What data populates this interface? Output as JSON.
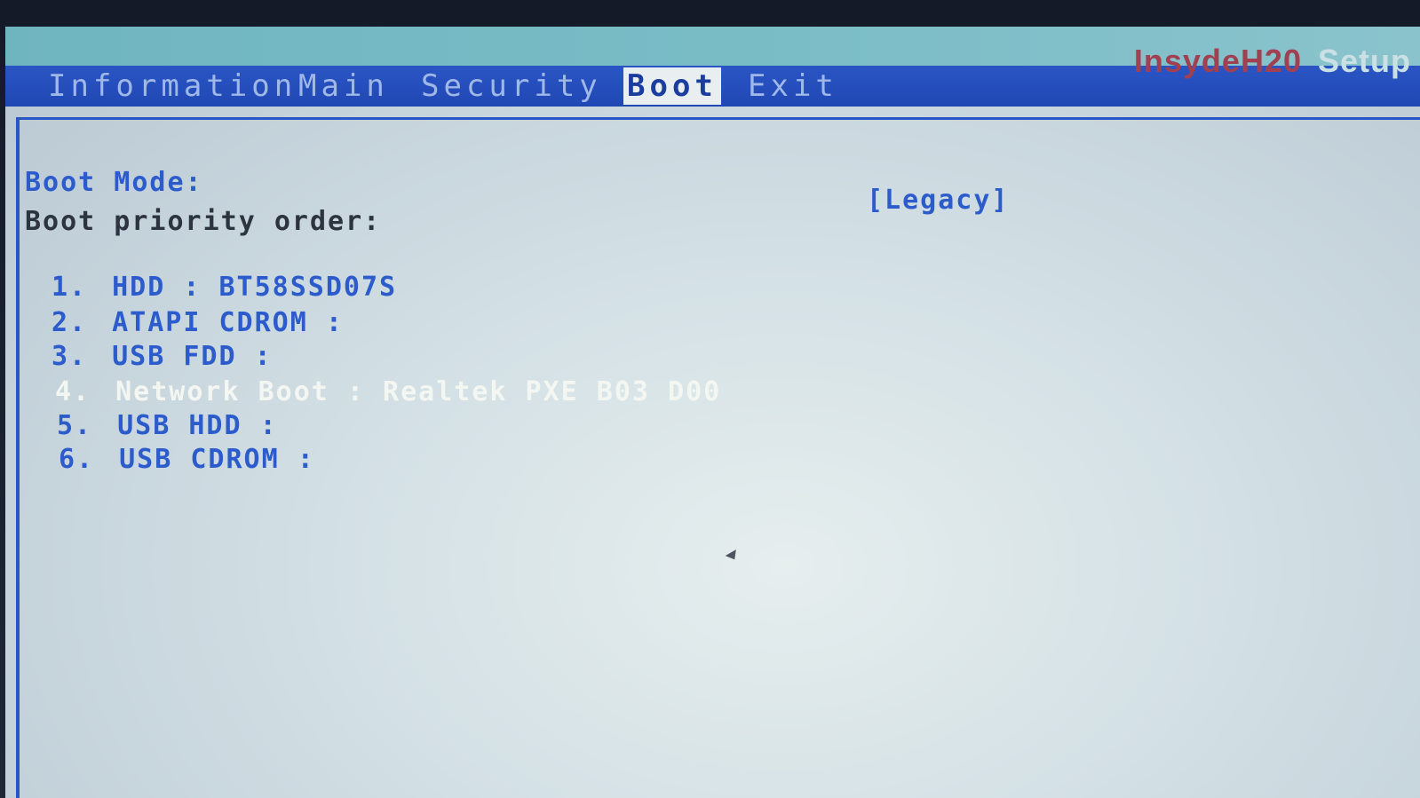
{
  "menubar": {
    "tabs": [
      {
        "label": "Information"
      },
      {
        "label": "Main"
      },
      {
        "label": "Security"
      },
      {
        "label": "Boot",
        "active": true
      },
      {
        "label": "Exit"
      }
    ],
    "brand": "InsydeH20",
    "brand_suffix": "Setup"
  },
  "boot": {
    "boot_mode_label": "Boot Mode:",
    "boot_mode_value": "[Legacy]",
    "priority_label": "Boot priority order:",
    "items": [
      {
        "num": "1.",
        "label": "HDD : BT58SSD07S"
      },
      {
        "num": "2.",
        "label": "ATAPI CDROM :"
      },
      {
        "num": "3.",
        "label": "USB FDD :"
      },
      {
        "num": "4.",
        "label": "Network Boot : Realtek PXE B03 D00",
        "selected": true
      },
      {
        "num": "5.",
        "label": "USB HDD :"
      },
      {
        "num": "6.",
        "label": "USB CDROM :"
      }
    ]
  },
  "colors": {
    "menubar_bg": "#2048b4",
    "text_blue": "#2c5ccc",
    "highlight_text": "#f4f6f2"
  }
}
